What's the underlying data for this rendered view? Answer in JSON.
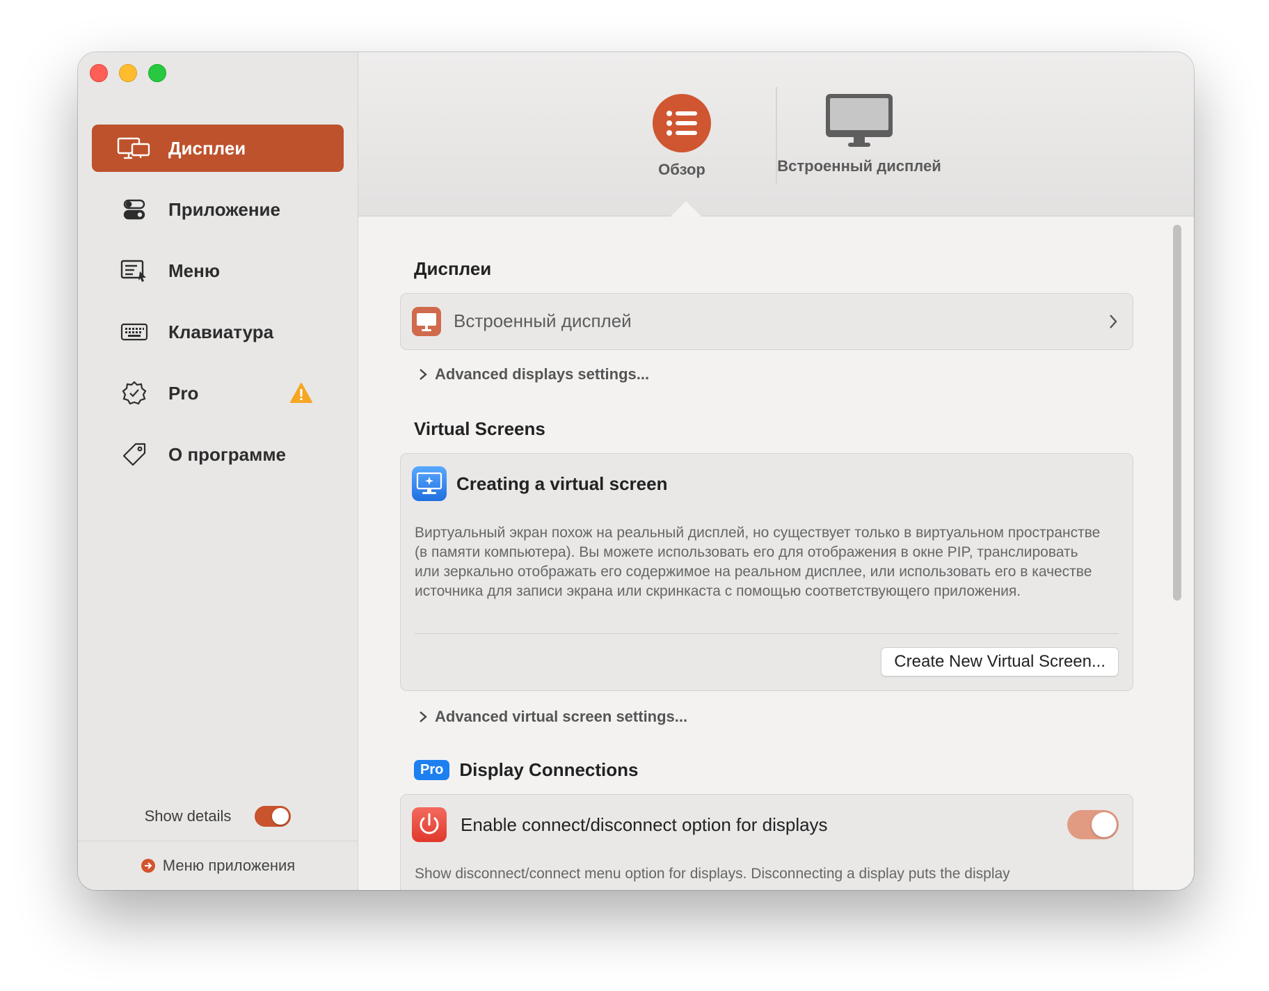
{
  "sidebar": {
    "items": [
      {
        "label": "Дисплеи",
        "icon": "displays-icon",
        "active": true
      },
      {
        "label": "Приложение",
        "icon": "toggles-icon"
      },
      {
        "label": "Меню",
        "icon": "menu-icon"
      },
      {
        "label": "Клавиатура",
        "icon": "keyboard-icon"
      },
      {
        "label": "Pro",
        "icon": "pro-badge-icon",
        "warning": true
      },
      {
        "label": "О программе",
        "icon": "tag-icon"
      }
    ],
    "show_details_label": "Show details",
    "show_details_on": true,
    "footer_label": "Меню приложения"
  },
  "toolbar": {
    "overview_label": "Обзор",
    "builtin_label": "Встроенный дисплей"
  },
  "content": {
    "displays_heading": "Дисплеи",
    "builtin_display_row": "Встроенный дисплей",
    "advanced_displays": "Advanced displays settings...",
    "virtual_heading": "Virtual Screens",
    "virtual_card_title": "Creating a virtual screen",
    "virtual_card_desc": "Виртуальный экран похож на реальный дисплей, но существует только в виртуальном пространстве (в памяти компьютера). Вы можете использовать его для отображения в окне PIP, транслировать или зеркально отображать его содержимое на реальном дисплее, или использовать его в качестве источника для записи экрана или скринкаста с помощью соответствующего приложения.",
    "create_button": "Create New Virtual Screen...",
    "advanced_virtual": "Advanced virtual screen settings...",
    "pro_badge": "Pro",
    "connections_heading": "Display Connections",
    "connections_row": "Enable connect/disconnect option for displays",
    "connections_on": true,
    "connections_desc": "Show disconnect/connect menu option for displays. Disconnecting a display puts the display"
  },
  "colors": {
    "accent": "#bd522c",
    "pro_blue": "#1d7ff0",
    "warning": "#f5a623"
  }
}
